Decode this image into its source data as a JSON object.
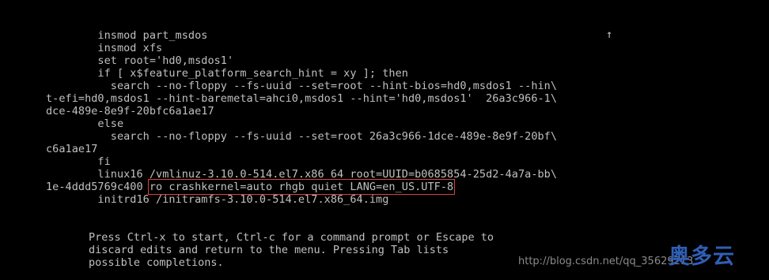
{
  "editor": {
    "lines": [
      "        insmod part_msdos",
      "        insmod xfs",
      "        set root='hd0,msdos1'",
      "        if [ x$feature_platform_search_hint = xy ]; then",
      "          search --no-floppy --fs-uuid --set=root --hint-bios=hd0,msdos1 --hin\\",
      "t-efi=hd0,msdos1 --hint-baremetal=ahci0,msdos1 --hint='hd0,msdos1'  26a3c966-1\\",
      "dce-489e-8e9f-20bfc6a1ae17",
      "        else",
      "          search --no-floppy --fs-uuid --set=root 26a3c966-1dce-489e-8e9f-20bf\\",
      "c6a1ae17",
      "        fi",
      "        linux16 /vmlinuz-3.10.0-514.el7.x86_64 root=UUID=b0685854-25d2-4a7a-bb\\"
    ],
    "uuid_tail": "1e-4ddd5769c400 ",
    "highlighted_args": "ro crashkernel=auto rhgb quiet LANG=en_US.UTF-8",
    "initrd_line": "        initrd16 /initramfs-3.10.0-514.el7.x86_64.img",
    "scroll_indicator": "↑"
  },
  "help": {
    "lines": [
      "Press Ctrl-x to start, Ctrl-c for a command prompt or Escape to",
      "discard edits and return to the menu. Pressing Tab lists",
      "possible completions."
    ]
  },
  "watermark": {
    "url": "http://blog.csdn.net/qq_35629213",
    "logo": "奥多云",
    "logo_color": "#2f5fb6"
  },
  "colors": {
    "background": "#000000",
    "text": "#c0c0c0",
    "highlight_border": "#d94040"
  }
}
